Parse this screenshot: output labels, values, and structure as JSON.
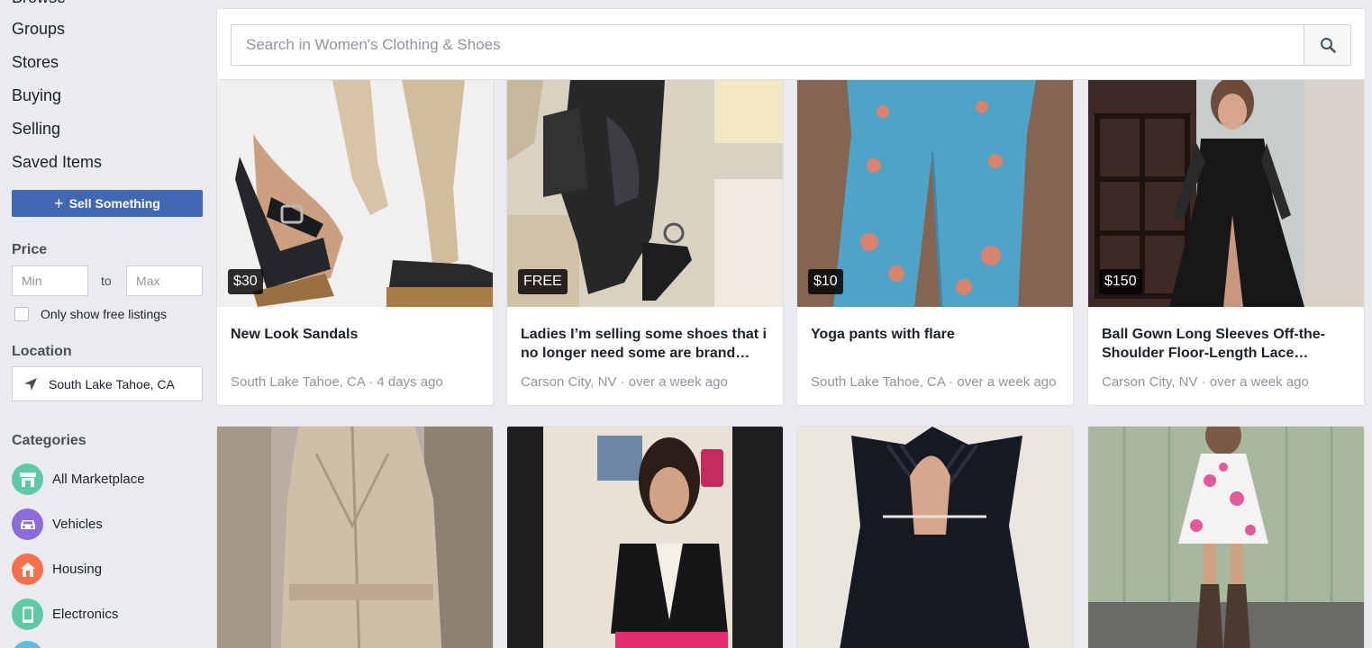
{
  "sidebar": {
    "nav": [
      "Browse",
      "Groups",
      "Stores",
      "Buying",
      "Selling",
      "Saved Items"
    ],
    "sell_label": "Sell Something",
    "price": {
      "title": "Price",
      "min_placeholder": "Min",
      "to_label": "to",
      "max_placeholder": "Max",
      "free_label": "Only show free listings"
    },
    "location": {
      "title": "Location",
      "value": "South Lake Tahoe, CA"
    },
    "categories": {
      "title": "Categories",
      "items": [
        {
          "label": "All Marketplace",
          "color": "#5fc9a5",
          "icon": "store-icon"
        },
        {
          "label": "Vehicles",
          "color": "#8b6cd9",
          "icon": "car-icon"
        },
        {
          "label": "Housing",
          "color": "#f5714d",
          "icon": "house-icon"
        },
        {
          "label": "Electronics",
          "color": "#5fc9a5",
          "icon": "phone-icon"
        }
      ]
    }
  },
  "search": {
    "placeholder": "Search in Women's Clothing & Shoes"
  },
  "listings": [
    {
      "price": "$30",
      "title": "New Look Sandals",
      "location": "South Lake Tahoe, CA",
      "time": "4 days ago"
    },
    {
      "price": "FREE",
      "title": "Ladies I’m selling some shoes that i no longer need some are brand…",
      "location": "Carson City, NV",
      "time": "over a week ago"
    },
    {
      "price": "$10",
      "title": "Yoga pants with flare",
      "location": "South Lake Tahoe, CA",
      "time": "over a week ago"
    },
    {
      "price": "$150",
      "title": "Ball Gown Long Sleeves Off-the-Shoulder Floor-Length Lace…",
      "location": "Carson City, NV",
      "time": "over a week ago"
    }
  ],
  "colors": {
    "accent": "#4267b2"
  }
}
